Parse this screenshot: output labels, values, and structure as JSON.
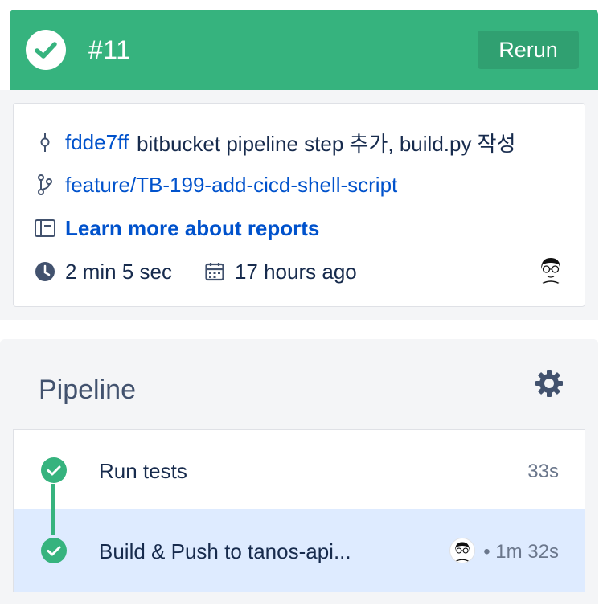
{
  "header": {
    "build_number": "#11",
    "rerun_label": "Rerun",
    "status_icon": "check-circle-icon",
    "color": "#36b37e"
  },
  "info": {
    "commit_hash": "fdde7ff",
    "commit_message": "bitbucket pipeline step 추가, build.py 작성",
    "branch": "feature/TB-199-add-cicd-shell-script",
    "reports_link": "Learn more about reports",
    "duration": "2 min 5 sec",
    "time_ago": "17 hours ago"
  },
  "pipeline": {
    "title": "Pipeline",
    "steps": [
      {
        "label": "Run tests",
        "duration": "33s",
        "status": "success"
      },
      {
        "label": "Build & Push to tanos-api...",
        "duration": "• 1m 32s",
        "status": "success",
        "selected": true
      }
    ]
  },
  "colors": {
    "success": "#36b37e",
    "link": "#0052cc",
    "selected_row": "#deebff"
  }
}
